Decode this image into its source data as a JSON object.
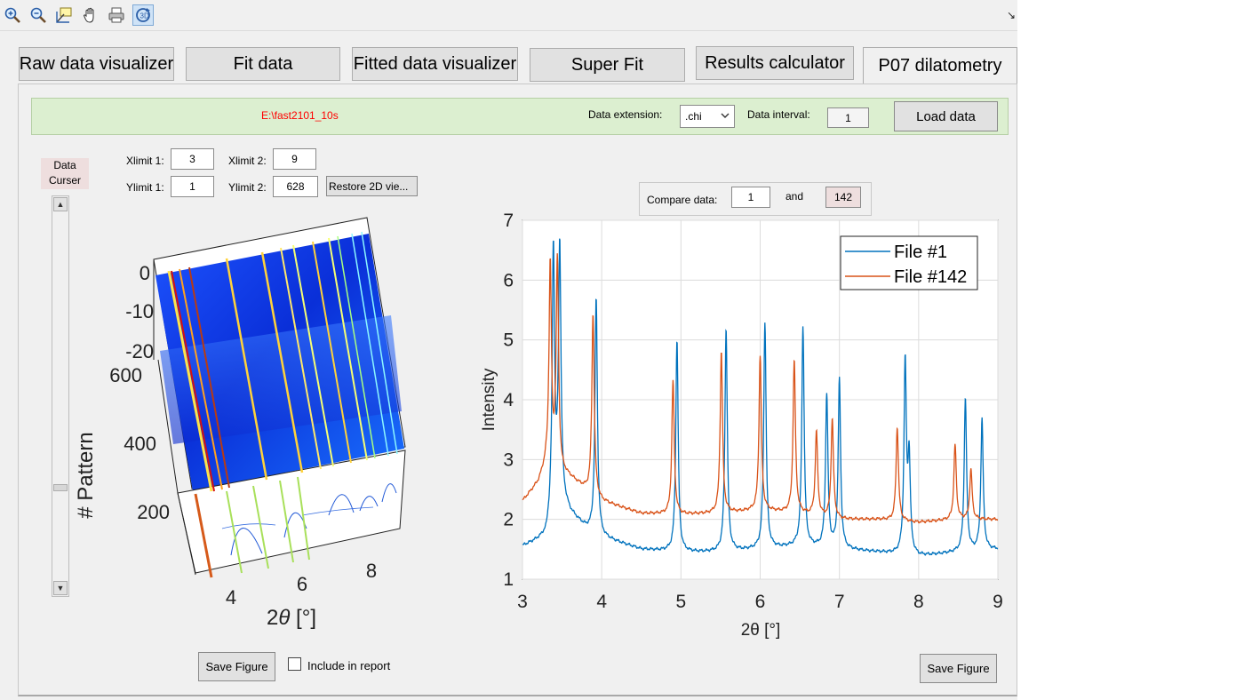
{
  "toolbar": {
    "icons": [
      "zoom-in-icon",
      "zoom-out-icon",
      "data-cursor-icon",
      "pan-hand-icon",
      "print-icon",
      "rotate-3d-icon"
    ],
    "corner_glyph": "↘"
  },
  "tabs": [
    {
      "label": "Raw data visualizer"
    },
    {
      "label": "Fit data"
    },
    {
      "label": "Fitted data visualizer"
    },
    {
      "label": "Super Fit"
    },
    {
      "label": "Results calculator"
    },
    {
      "label": "P07 dilatometry"
    }
  ],
  "loader": {
    "path": "E:\\fast2101_10s",
    "path_color": "#ff0000",
    "extension_label": "Data extension:",
    "extension_value": ".chi",
    "interval_label": "Data interval:",
    "interval_value": "1",
    "load_button": "Load data"
  },
  "cursor": {
    "label_line1": "Data",
    "label_line2": "Curser",
    "slider_level": 0.25
  },
  "limits": {
    "xlimit1_label": "Xlimit 1:",
    "xlimit1": "3",
    "xlimit2_label": "Xlimit 2:",
    "xlimit2": "9",
    "ylimit1_label": "Ylimit 1:",
    "ylimit1": "1",
    "ylimit2_label": "Ylimit 2:",
    "ylimit2": "628",
    "restore_button": "Restore 2D vie..."
  },
  "compare": {
    "label": "Compare data:",
    "first": "1",
    "and_label": "and",
    "second": "142"
  },
  "left_plot": {
    "ylabel": "# Pattern",
    "xlabel_prefix": "2",
    "xlabel_theta": "θ",
    "xlabel_unit": " [°]",
    "z_ticks": [
      "0",
      "-10",
      "-20"
    ],
    "y_ticks": [
      "600",
      "400",
      "200"
    ],
    "x_ticks": [
      "4",
      "6",
      "8"
    ],
    "save_button": "Save Figure",
    "include_label": "Include in report"
  },
  "chart_data": {
    "type": "line",
    "xlabel": "2θ [°]",
    "ylabel": "Intensity",
    "xlim": [
      3,
      9
    ],
    "ylim": [
      1,
      7
    ],
    "x_ticks": [
      3,
      4,
      5,
      6,
      7,
      8,
      9
    ],
    "y_ticks": [
      1,
      2,
      3,
      4,
      5,
      6,
      7
    ],
    "grid": true,
    "legend_position": "top-right",
    "series": [
      {
        "name": "File #1",
        "color": "#0072bd",
        "baseline": [
          [
            3.0,
            1.55
          ],
          [
            3.3,
            1.7
          ],
          [
            3.45,
            2.4
          ],
          [
            3.6,
            2.1
          ],
          [
            3.8,
            1.85
          ],
          [
            4.0,
            1.7
          ],
          [
            4.5,
            1.5
          ],
          [
            5.0,
            1.45
          ],
          [
            5.5,
            1.45
          ],
          [
            6.0,
            1.5
          ],
          [
            6.5,
            1.55
          ],
          [
            7.0,
            1.5
          ],
          [
            7.5,
            1.45
          ],
          [
            8.0,
            1.38
          ],
          [
            8.5,
            1.45
          ],
          [
            9.0,
            1.5
          ]
        ],
        "peaks": [
          [
            3.39,
            6.5
          ],
          [
            3.47,
            6.55
          ],
          [
            3.93,
            5.7
          ],
          [
            4.95,
            5.0
          ],
          [
            5.57,
            5.2
          ],
          [
            6.06,
            5.3
          ],
          [
            6.54,
            5.22
          ],
          [
            6.84,
            4.07
          ],
          [
            7.0,
            4.33
          ],
          [
            7.83,
            4.58
          ],
          [
            7.88,
            2.95
          ],
          [
            8.59,
            4.02
          ],
          [
            8.8,
            3.67
          ]
        ]
      },
      {
        "name": "File #142",
        "color": "#d95319",
        "baseline": [
          [
            3.0,
            2.3
          ],
          [
            3.2,
            2.6
          ],
          [
            3.3,
            2.9
          ],
          [
            3.6,
            2.7
          ],
          [
            3.85,
            2.45
          ],
          [
            4.0,
            2.3
          ],
          [
            4.5,
            2.1
          ],
          [
            5.0,
            2.08
          ],
          [
            5.5,
            2.1
          ],
          [
            6.0,
            2.15
          ],
          [
            6.5,
            2.1
          ],
          [
            7.0,
            2.0
          ],
          [
            7.5,
            2.0
          ],
          [
            8.0,
            1.95
          ],
          [
            8.5,
            2.0
          ],
          [
            9.0,
            2.0
          ]
        ],
        "peaks": [
          [
            3.35,
            6.25
          ],
          [
            3.44,
            6.3
          ],
          [
            3.89,
            5.43
          ],
          [
            4.9,
            4.32
          ],
          [
            5.51,
            4.8
          ],
          [
            6.0,
            4.73
          ],
          [
            6.43,
            4.65
          ],
          [
            6.71,
            3.47
          ],
          [
            6.91,
            3.67
          ],
          [
            7.73,
            3.55
          ],
          [
            8.46,
            3.25
          ],
          [
            8.66,
            2.83
          ]
        ]
      }
    ]
  },
  "right_save_button": "Save Figure"
}
